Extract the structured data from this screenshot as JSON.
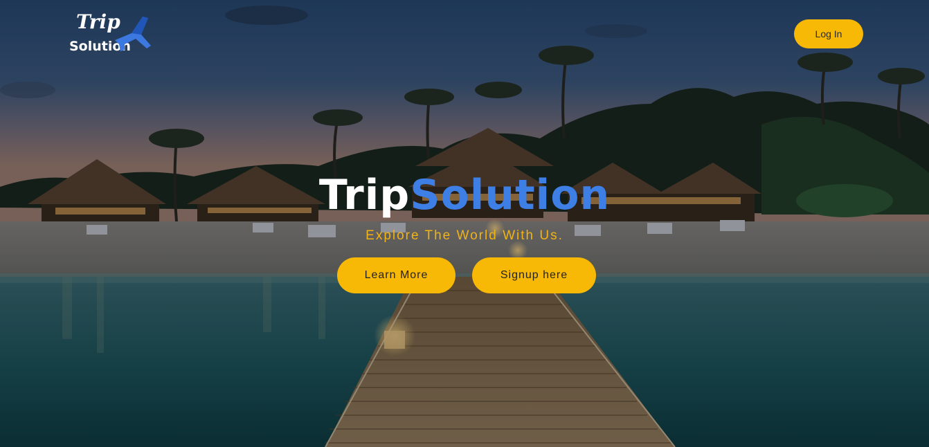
{
  "brand": {
    "logo_line1": "Trip",
    "logo_line2": "Solution"
  },
  "nav": {
    "login_label": "Log In"
  },
  "hero": {
    "title_part1": "Trip",
    "title_part2": "Solution",
    "tagline": "Explore The World With Us.",
    "learn_more_label": "Learn More",
    "signup_label": "Signup here"
  },
  "colors": {
    "accent": "#f8b806",
    "title_blue": "#3e7fe6",
    "tagline": "#f2b315"
  },
  "background": {
    "scene": "beach-resort-boardwalk-sunset",
    "icon": "plane-icon"
  }
}
